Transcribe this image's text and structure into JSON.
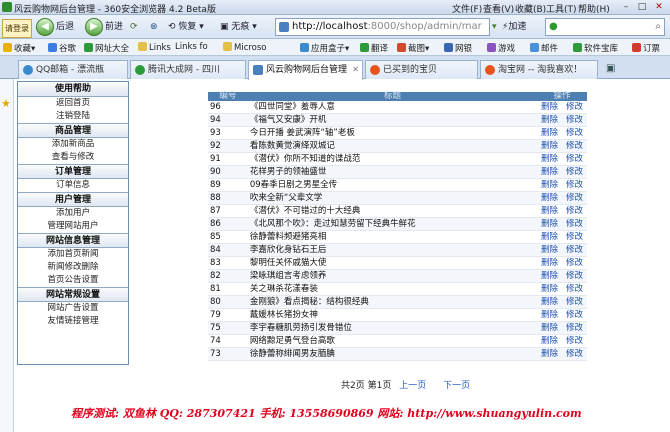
{
  "window": {
    "title": "风云购物网后台管理 - 360安全浏览器 4.2 Beta版",
    "menus": [
      "文件(F)",
      "查看(V)",
      "收藏(B)",
      "工具(T)",
      "帮助(H)"
    ]
  },
  "navbar": {
    "login_label": "请登录",
    "back_label": "后退",
    "forward_label": "前进",
    "restore_label": "恢复",
    "no_image_label": "无痕",
    "address_host": "http://localhost",
    "address_rest": ":8000/shop/admin/mar",
    "accelerate_label": "加速"
  },
  "favorites": {
    "label": "收藏",
    "items": [
      "谷歌",
      "网址大全",
      "Links",
      "Links fo",
      "Microso",
      "应用盒子",
      "翻译",
      "截图",
      "网银",
      "游戏",
      "邮件",
      "软件宝库",
      "订票"
    ]
  },
  "tabs": [
    {
      "label": "QQ邮箱 - 漂流瓶"
    },
    {
      "label": "腾讯大成网 - 四川"
    },
    {
      "label": "风云购物网后台管理"
    },
    {
      "label": "已买到的宝贝"
    },
    {
      "label": "淘宝网 -- 淘我喜欢！"
    }
  ],
  "sidebar": {
    "sections": [
      {
        "header": "使用帮助",
        "items": [
          "返回首页",
          "注销登陆"
        ]
      },
      {
        "header": "商品管理",
        "items": [
          "添加新商品",
          "查看与修改"
        ]
      },
      {
        "header": "订单管理",
        "items": [
          "订单信息"
        ]
      },
      {
        "header": "用户管理",
        "items": [
          "添加用户",
          "管理网站用户"
        ]
      },
      {
        "header": "网站信息管理",
        "items": [
          "添加首页新闻",
          "新闻修改删除",
          "首页公告设置"
        ]
      },
      {
        "header": "网站常规设置",
        "items": [
          "网站广告设置",
          "友情链接管理"
        ]
      }
    ]
  },
  "table": {
    "headers": [
      "编号",
      "标题",
      "操作"
    ],
    "delete_label": "删除",
    "edit_label": "修改",
    "rows": [
      {
        "id": "96",
        "title": "《四世同堂》羞辱人意"
      },
      {
        "id": "94",
        "title": "《福气又安康》开机"
      },
      {
        "id": "93",
        "title": "今日开播 姜武演阵“轴”老板"
      },
      {
        "id": "92",
        "title": "看陈数黄觉演绎双城记"
      },
      {
        "id": "91",
        "title": "《潜伏》你所不知道的谍战范"
      },
      {
        "id": "90",
        "title": "花样男子的领袖盛世"
      },
      {
        "id": "89",
        "title": "09春季日剧之男星全传"
      },
      {
        "id": "88",
        "title": "吹来全新“父辈文学"
      },
      {
        "id": "87",
        "title": "《潜伏》不可错过的十大经典"
      },
      {
        "id": "86",
        "title": "《北风那个吹》：走过知慧劳留下经典牛鲜花"
      },
      {
        "id": "85",
        "title": "徐静蕾料频避猪亮相"
      },
      {
        "id": "84",
        "title": "李嘉欣化身钻石王后"
      },
      {
        "id": "83",
        "title": "黎明任关怀戚猫大使"
      },
      {
        "id": "82",
        "title": "梁咏琪组言考虑领养"
      },
      {
        "id": "81",
        "title": "关之琳杀花漾春装"
      },
      {
        "id": "80",
        "title": "金刚狼》看点揭秘：结构很经典"
      },
      {
        "id": "79",
        "title": "戴媛林长猪扮女神"
      },
      {
        "id": "75",
        "title": "李宇春糖肌劳扬引发骨错位"
      },
      {
        "id": "74",
        "title": "网络黥足勇气登台高歌"
      },
      {
        "id": "73",
        "title": "徐静蕾称绯闻男友腼腆"
      }
    ]
  },
  "pager": {
    "summary": "共2页 第1页",
    "prev_label": "上一页",
    "next_label": "下一页"
  },
  "footer": {
    "text": "程序测试: 双鱼林   QQ: 287307421   手机: 13558690869   网站: http://www.shuangyulin.com"
  }
}
